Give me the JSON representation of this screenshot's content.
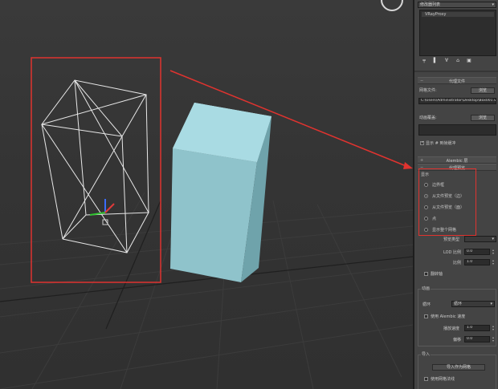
{
  "colors": {
    "highlight": "#e0332f",
    "cube": "#a9dbe3",
    "panel": "#444444",
    "viewport": "#343434"
  },
  "modifier_list": {
    "title": "修改器列表",
    "selected_item": "VRayProxy"
  },
  "stack_toolbar": [
    {
      "name": "pin-stack-icon",
      "glyph": "╤"
    },
    {
      "name": "show-end-result-icon",
      "glyph": "▌"
    },
    {
      "name": "make-unique-icon",
      "glyph": "∀"
    },
    {
      "name": "remove-modifier-icon",
      "glyph": "⌂"
    },
    {
      "name": "configure-sets-icon",
      "glyph": "▣"
    }
  ],
  "proxy_file": {
    "title": "代理文件",
    "mesh_file_label": "网格文件:",
    "browse_label": "浏览",
    "mesh_path": "C:\\Users\\Administrator\\Desktop\\Box001.vrmesh",
    "anim_override_label": "动画覆盖:",
    "browse2_label": "浏览",
    "show_in_viewport_label": "显示 # 到帧缓冲"
  },
  "alembic": {
    "title": "Alembic 层"
  },
  "proxy_preview": {
    "title": "代理预览",
    "display_label": "显示",
    "options": [
      "边界框",
      "从文件预览（边）",
      "从文件预览（面）",
      "点",
      "显示整个网格"
    ],
    "selected_index": 1,
    "preview_type_label": "预览类型",
    "lod_label": "LOD 比例",
    "lod_value": "0.0",
    "scale_label": "比例",
    "scale_value": "1.0",
    "flip_axis_label": "翻转轴"
  },
  "anim": {
    "title": "动画",
    "mode_label": "循环",
    "play_label": "循环",
    "alembic_sync_label": "使用 Alembic 速度",
    "start_label": "播放速度",
    "start_value": "1.0",
    "offset_label": "偏移",
    "offset_value": "0.0"
  },
  "import": {
    "title": "导入",
    "import_button_label": "导入作为网格",
    "use_custom_label": "使用网格法线"
  }
}
